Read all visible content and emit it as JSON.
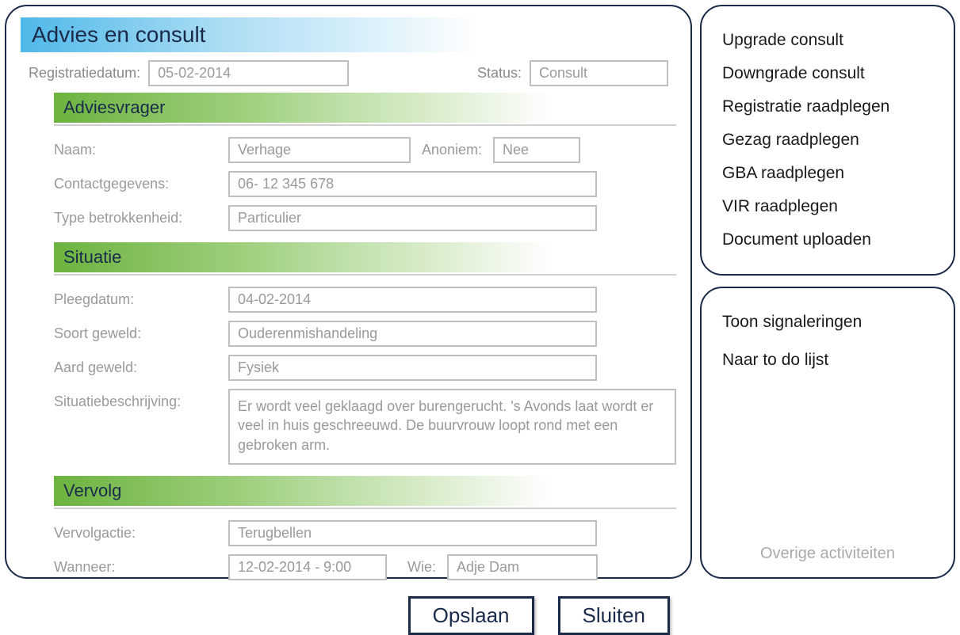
{
  "header": {
    "title": "Advies en consult",
    "reg_label": "Registratiedatum:",
    "reg_value": "05-02-2014",
    "status_label": "Status:",
    "status_value": "Consult"
  },
  "sections": {
    "adviesvrager": {
      "title": "Adviesvrager",
      "naam_label": "Naam:",
      "naam_value": "Verhage",
      "anoniem_label": "Anoniem:",
      "anoniem_value": "Nee",
      "contact_label": "Contactgegevens:",
      "contact_value": "06- 12 345 678",
      "type_label": "Type betrokkenheid:",
      "type_value": "Particulier"
    },
    "situatie": {
      "title": "Situatie",
      "pleeg_label": "Pleegdatum:",
      "pleeg_value": "04-02-2014",
      "soort_label": "Soort geweld:",
      "soort_value": "Ouderenmishandeling",
      "aard_label": "Aard geweld:",
      "aard_value": "Fysiek",
      "beschrijving_label": "Situatiebeschrijving:",
      "beschrijving_value": "Er wordt veel geklaagd over burengerucht. 's Avonds laat wordt er veel in huis geschreeuwd. De buurvrouw loopt rond met een gebroken arm."
    },
    "vervolg": {
      "title": "Vervolg",
      "actie_label": "Vervolgactie:",
      "actie_value": "Terugbellen",
      "wanneer_label": "Wanneer:",
      "wanneer_value": "12-02-2014 - 9:00",
      "wie_label": "Wie:",
      "wie_value": "Adje Dam"
    }
  },
  "buttons": {
    "save": "Opslaan",
    "close": "Sluiten"
  },
  "sidebar": {
    "top": [
      "Upgrade consult",
      "Downgrade consult",
      "Registratie raadplegen",
      "Gezag raadplegen",
      "GBA raadplegen",
      "VIR raadplegen",
      "Document uploaden"
    ],
    "bottom": [
      "Toon signaleringen",
      "Naar to do lijst"
    ],
    "footer": "Overige activiteiten"
  }
}
